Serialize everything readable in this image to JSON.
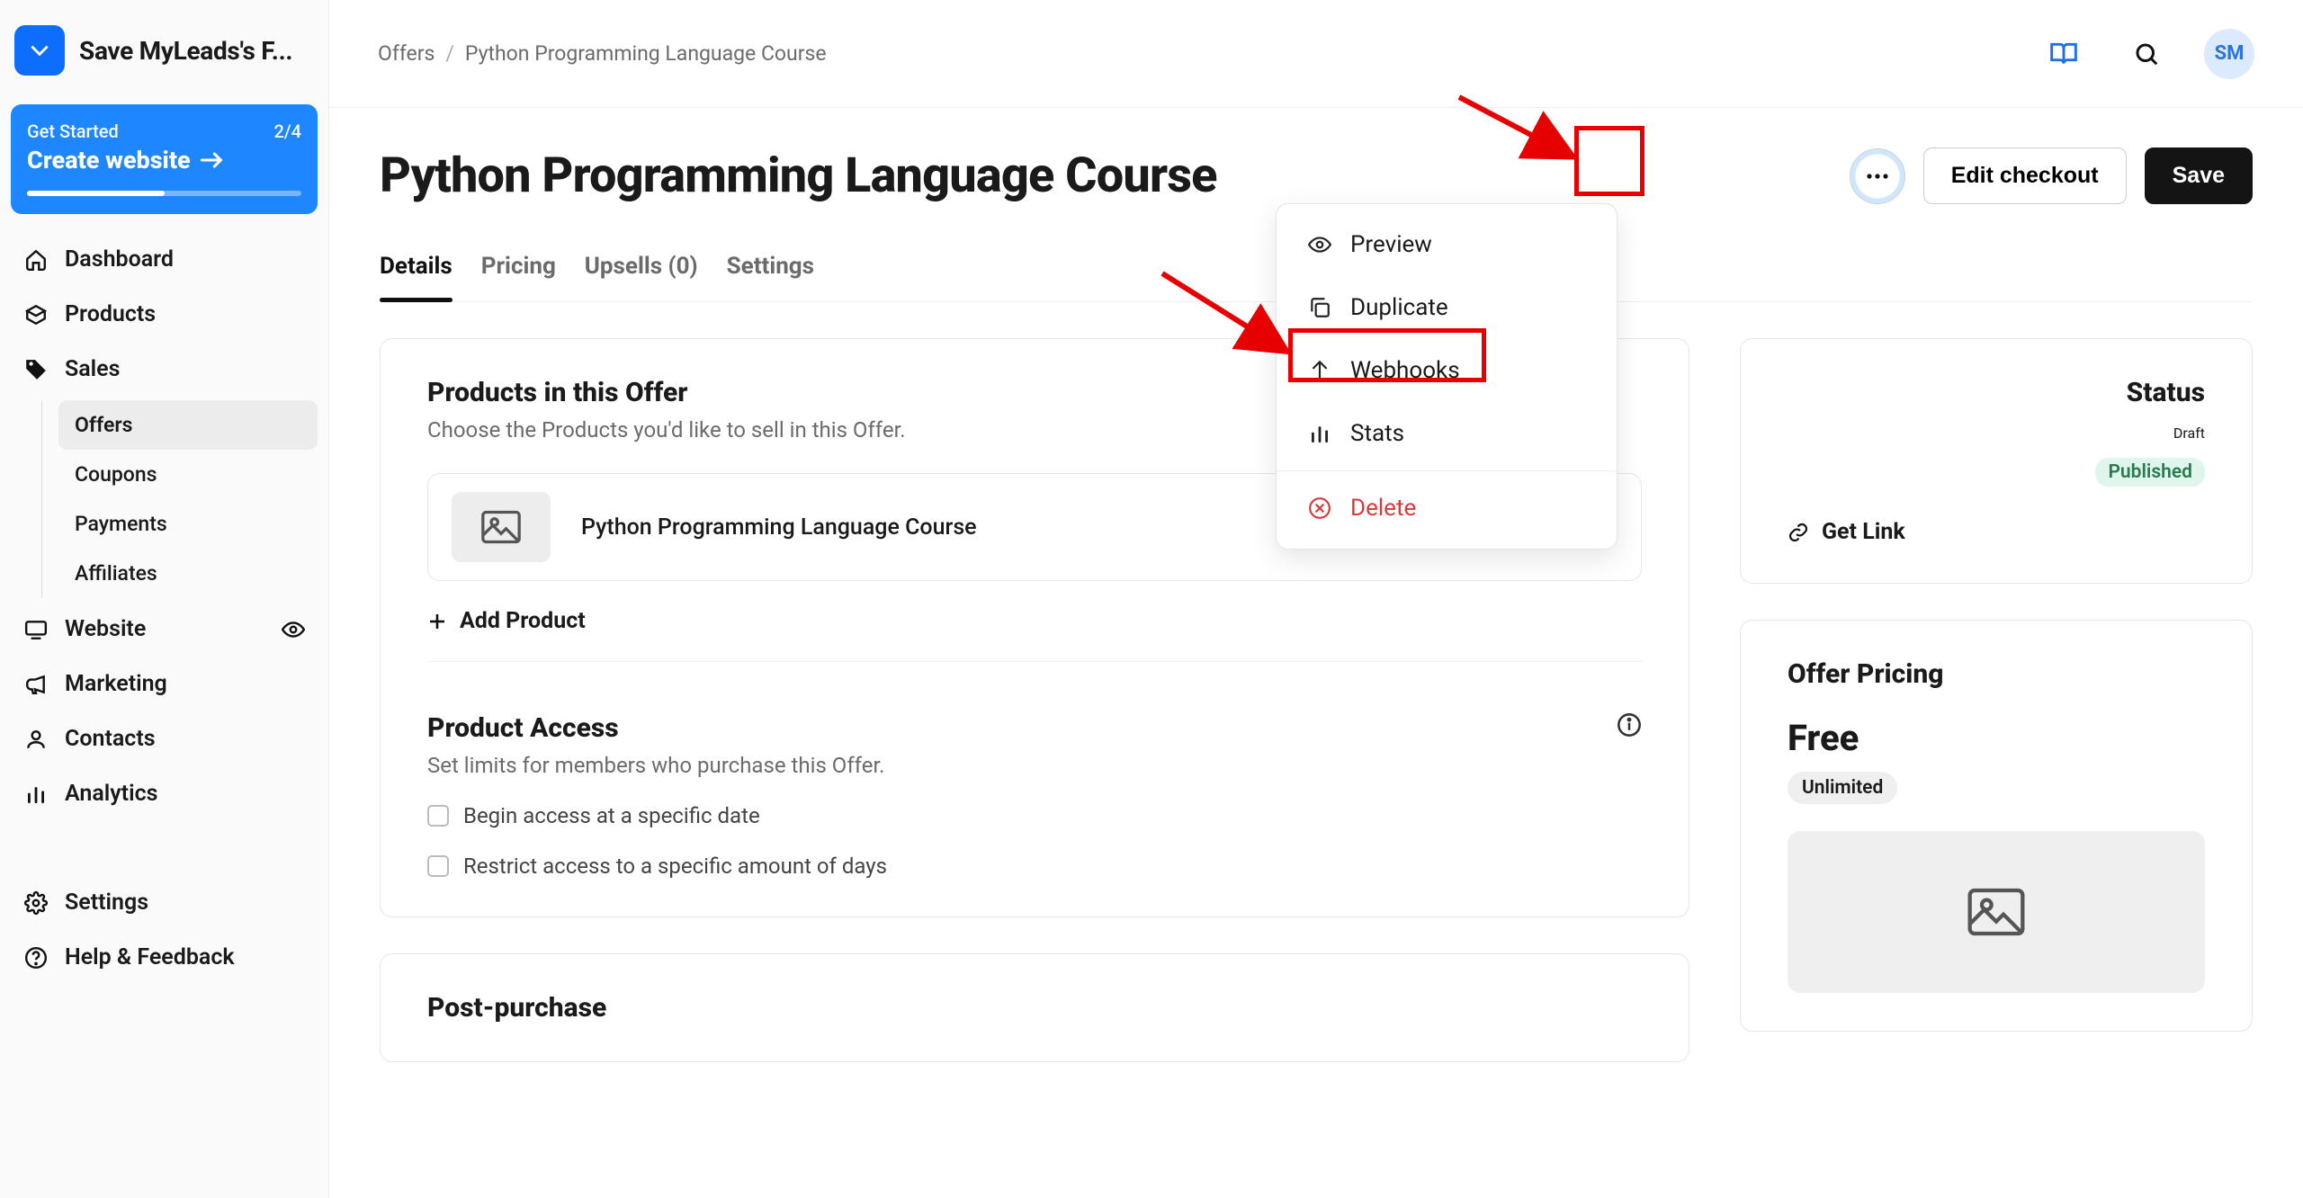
{
  "brand": {
    "name": "Save MyLeads's F..."
  },
  "getStarted": {
    "label": "Get Started",
    "progressText": "2/4",
    "title": "Create website",
    "progressPct": 50
  },
  "nav": {
    "dashboard": "Dashboard",
    "products": "Products",
    "sales": "Sales",
    "salesChildren": {
      "offers": "Offers",
      "coupons": "Coupons",
      "payments": "Payments",
      "affiliates": "Affiliates"
    },
    "website": "Website",
    "marketing": "Marketing",
    "contacts": "Contacts",
    "analytics": "Analytics",
    "settings": "Settings",
    "help": "Help & Feedback"
  },
  "breadcrumb": {
    "root": "Offers",
    "current": "Python Programming Language Course"
  },
  "avatar": "SM",
  "page": {
    "title": "Python Programming Language Course",
    "editCheckout": "Edit checkout",
    "save": "Save"
  },
  "tabs": {
    "details": "Details",
    "pricing": "Pricing",
    "upsells": "Upsells (0)",
    "settings": "Settings"
  },
  "productsCard": {
    "heading": "Products in this Offer",
    "sub": "Choose the Products you'd like to sell in this Offer.",
    "item1": "Python Programming Language Course",
    "add": "Add Product"
  },
  "accessCard": {
    "heading": "Product Access",
    "sub": "Set limits for members who purchase this Offer.",
    "opt1": "Begin access at a specific date",
    "opt2": "Restrict access to a specific amount of days"
  },
  "postPurchase": {
    "heading": "Post-purchase"
  },
  "statusCard": {
    "heading": "Status",
    "draft": "Draft",
    "published": "Published",
    "getLink": "Get Link"
  },
  "pricingCard": {
    "heading": "Offer Pricing",
    "price": "Free",
    "pill": "Unlimited"
  },
  "dropdown": {
    "preview": "Preview",
    "duplicate": "Duplicate",
    "webhooks": "Webhooks",
    "stats": "Stats",
    "delete": "Delete"
  }
}
